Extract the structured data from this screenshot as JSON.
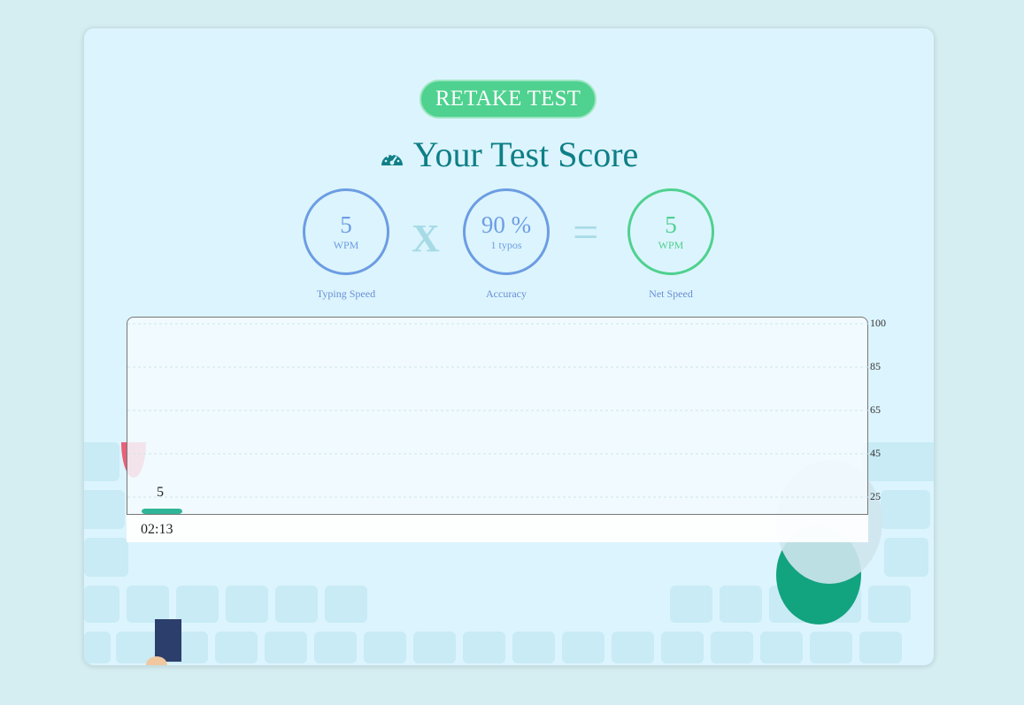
{
  "retake_button": {
    "label": "RETAKE TEST"
  },
  "title": {
    "text": "Your Test Score",
    "icon": "gauge-icon"
  },
  "stats": {
    "typing_speed": {
      "value": "5",
      "unit": "WPM",
      "caption": "Typing Speed"
    },
    "accuracy": {
      "value": "90 %",
      "unit": "1 typos",
      "caption": "Accuracy"
    },
    "net_speed": {
      "value": "5",
      "unit": "WPM",
      "caption": "Net Speed"
    }
  },
  "operators": {
    "multiply": "X",
    "equals": "="
  },
  "colors": {
    "accent_green": "#4fd18f",
    "accent_blue": "#6c9de3",
    "title_teal": "#0e7f86",
    "background": "#dcf4fd"
  },
  "chart_data": {
    "type": "bar",
    "categories": [
      "02:13"
    ],
    "values": [
      5
    ],
    "y_ticks": [
      "100",
      "85",
      "65",
      "45",
      "25"
    ],
    "ylim": [
      0,
      100
    ],
    "grid": true,
    "bar_color": "#2fb597"
  }
}
